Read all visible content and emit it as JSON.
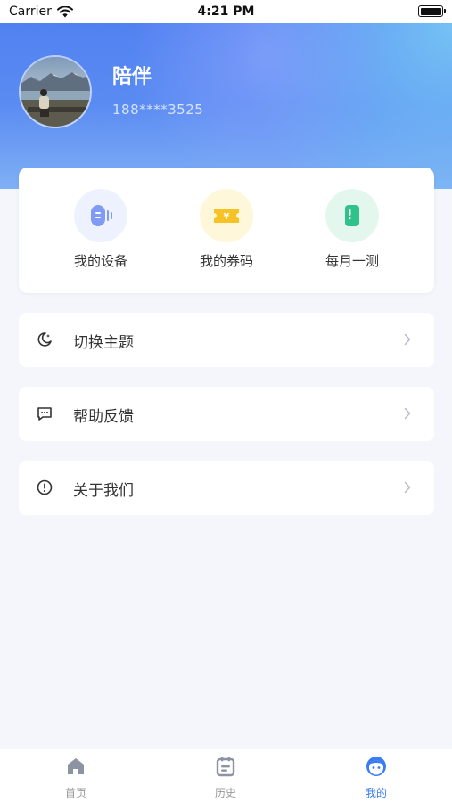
{
  "status_bar": {
    "carrier": "Carrier",
    "time": "4:21 PM"
  },
  "profile": {
    "name": "陪伴",
    "phone": "188****3525"
  },
  "quick_actions": [
    {
      "label": "我的设备",
      "icon": "device-icon",
      "color": "#6f8ff2"
    },
    {
      "label": "我的券码",
      "icon": "ticket-icon",
      "color": "#f7c226"
    },
    {
      "label": "每月一测",
      "icon": "test-icon",
      "color": "#2fc28a"
    }
  ],
  "menu": [
    {
      "label": "切换主题",
      "icon": "moon-icon"
    },
    {
      "label": "帮助反馈",
      "icon": "feedback-icon"
    },
    {
      "label": "关于我们",
      "icon": "info-icon"
    }
  ],
  "tabs": [
    {
      "label": "首页",
      "icon": "home-icon",
      "active": false
    },
    {
      "label": "历史",
      "icon": "calendar-icon",
      "active": false
    },
    {
      "label": "我的",
      "icon": "profile-face-icon",
      "active": true
    }
  ],
  "colors": {
    "accent": "#3b7cf0",
    "inactive": "#999999",
    "background": "#f4f6fb"
  }
}
